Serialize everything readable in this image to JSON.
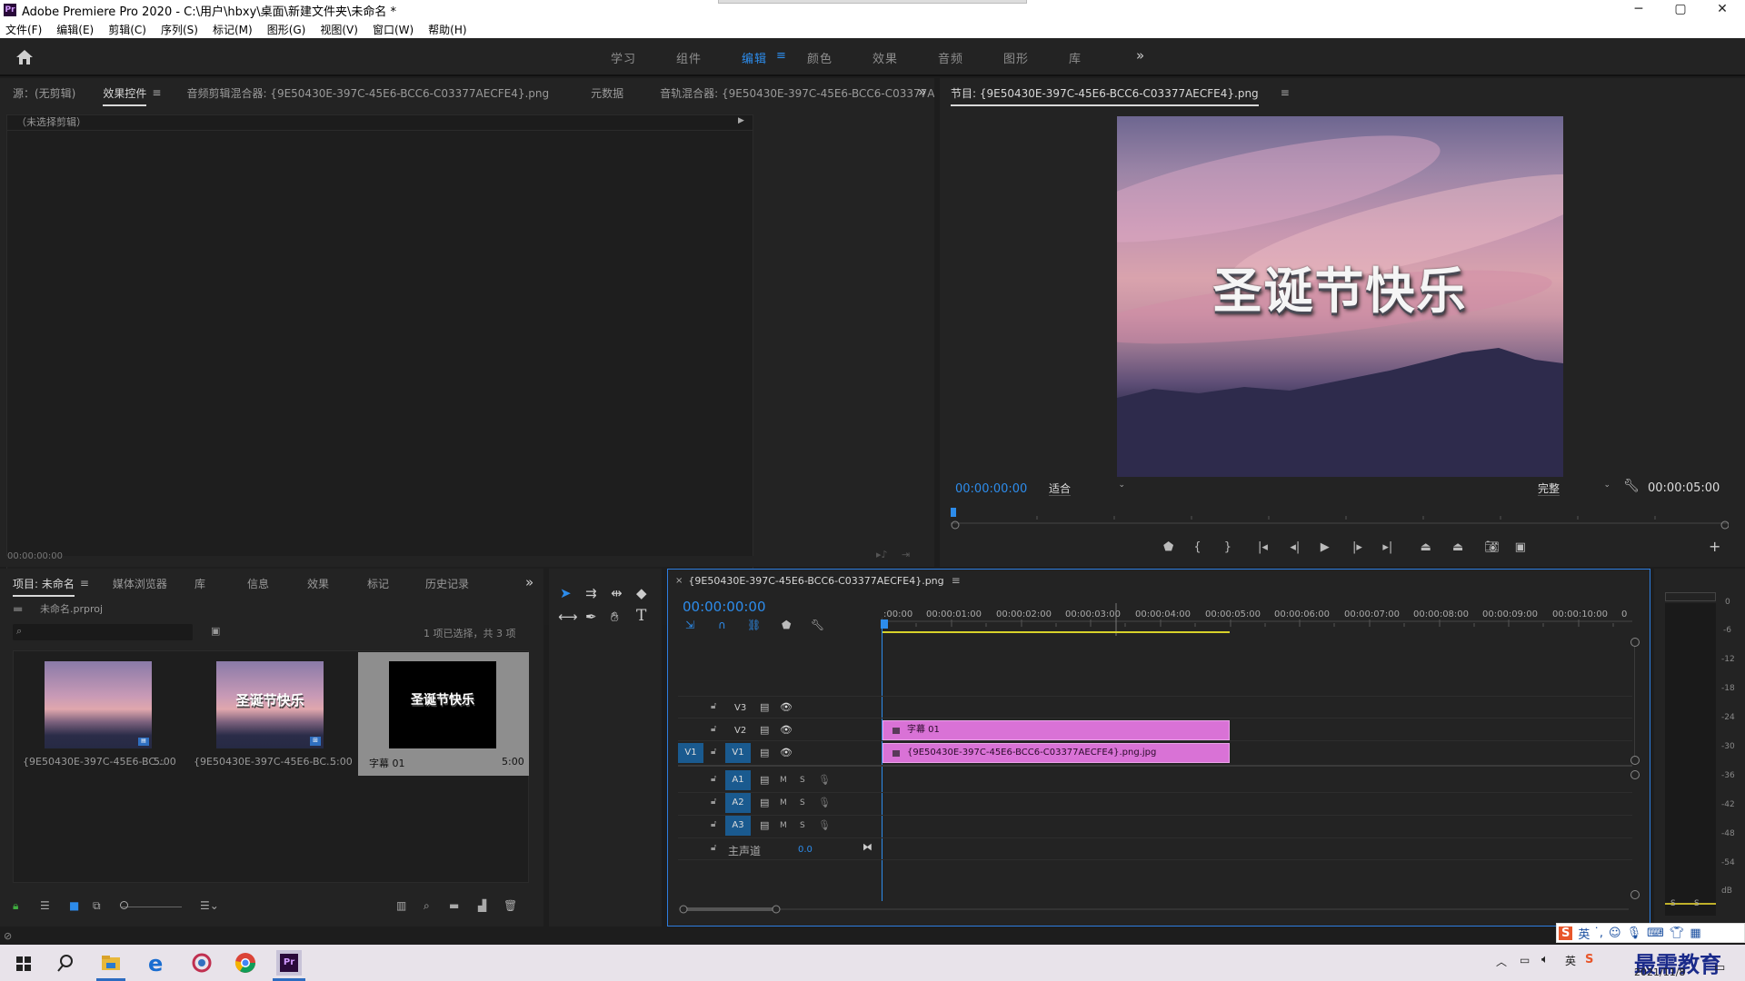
{
  "window": {
    "title": "Adobe Premiere Pro 2020 - C:\\用户\\hbxy\\桌面\\新建文件夹\\未命名 *",
    "logo": "Pr",
    "min": "─",
    "restore": "▢",
    "close": "✕"
  },
  "menus": [
    "文件(F)",
    "编辑(E)",
    "剪辑(C)",
    "序列(S)",
    "标记(M)",
    "图形(G)",
    "视图(V)",
    "窗口(W)",
    "帮助(H)"
  ],
  "workspaces": [
    "学习",
    "组件",
    "编辑",
    "颜色",
    "效果",
    "音频",
    "图形",
    "库"
  ],
  "upper_left_tabs": {
    "source": "源：(无剪辑)",
    "effect_controls": "效果控件",
    "audio_clip_mixer": "音频剪辑混合器: {9E50430E-397C-45E6-BCC6-C03377AECFE4}.png",
    "metadata": "元数据",
    "audio_track_mixer": "音轨混合器: {9E50430E-397C-45E6-BCC6-C03377AECFE"
  },
  "effect_controls": {
    "no_clip": "（未选择剪辑）",
    "timecode": "00:00:00:00"
  },
  "program": {
    "title": "节目: {9E50430E-397C-45E6-BCC6-C03377AECFE4}.png",
    "overlay_text": "圣诞节快乐",
    "timecode": "00:00:00:00",
    "fit": "适合",
    "quality": "完整",
    "duration": "00:00:05:00"
  },
  "project": {
    "tabs": [
      "项目: 未命名",
      "媒体浏览器",
      "库",
      "信息",
      "效果",
      "标记",
      "历史记录"
    ],
    "file": "未命名.prproj",
    "selection": "1 项已选择，共 3 项",
    "items": [
      {
        "name": "{9E50430E-397C-45E6-BC...",
        "duration": "5:00"
      },
      {
        "name": "{9E50430E-397C-45E6-BC...",
        "duration": "5:00",
        "overlay": "圣诞节快乐"
      },
      {
        "name": "字幕 01",
        "duration": "5:00",
        "overlay": "圣诞节快乐"
      }
    ]
  },
  "timeline": {
    "tab": "{9E50430E-397C-45E6-BCC6-C03377AECFE4}.png",
    "timecode": "00:00:00:00",
    "ruler": [
      ":00:00",
      "00:00:01:00",
      "00:00:02:00",
      "00:00:03:00",
      "00:00:04:00",
      "00:00:05:00",
      "00:00:06:00",
      "00:00:07:00",
      "00:00:08:00",
      "00:00:09:00",
      "00:00:10:00",
      "0"
    ],
    "video_tracks": [
      "V3",
      "V2",
      "V1"
    ],
    "audio_tracks": [
      "A1",
      "A2",
      "A3"
    ],
    "source_patch": "V1",
    "mute": "M",
    "solo": "S",
    "master": "主声道",
    "master_value": "0.0",
    "clips": {
      "v2": "字幕 01",
      "v1": "{9E50430E-397C-45E6-BCC6-C03377AECFE4}.png.jpg"
    }
  },
  "meter": {
    "labels": [
      "0",
      "-6",
      "-12",
      "-18",
      "-24",
      "-30",
      "-36",
      "-42",
      "-48",
      "-54",
      "dB"
    ],
    "solo": [
      "S",
      "S"
    ]
  },
  "taskbar": {
    "ime_lang": "英",
    "date": "2021/11/8",
    "brand": "最需教育"
  },
  "colors": {
    "accent": "#2d8ceb",
    "clip": "#d972d6",
    "playhead": "#2d8ceb"
  }
}
